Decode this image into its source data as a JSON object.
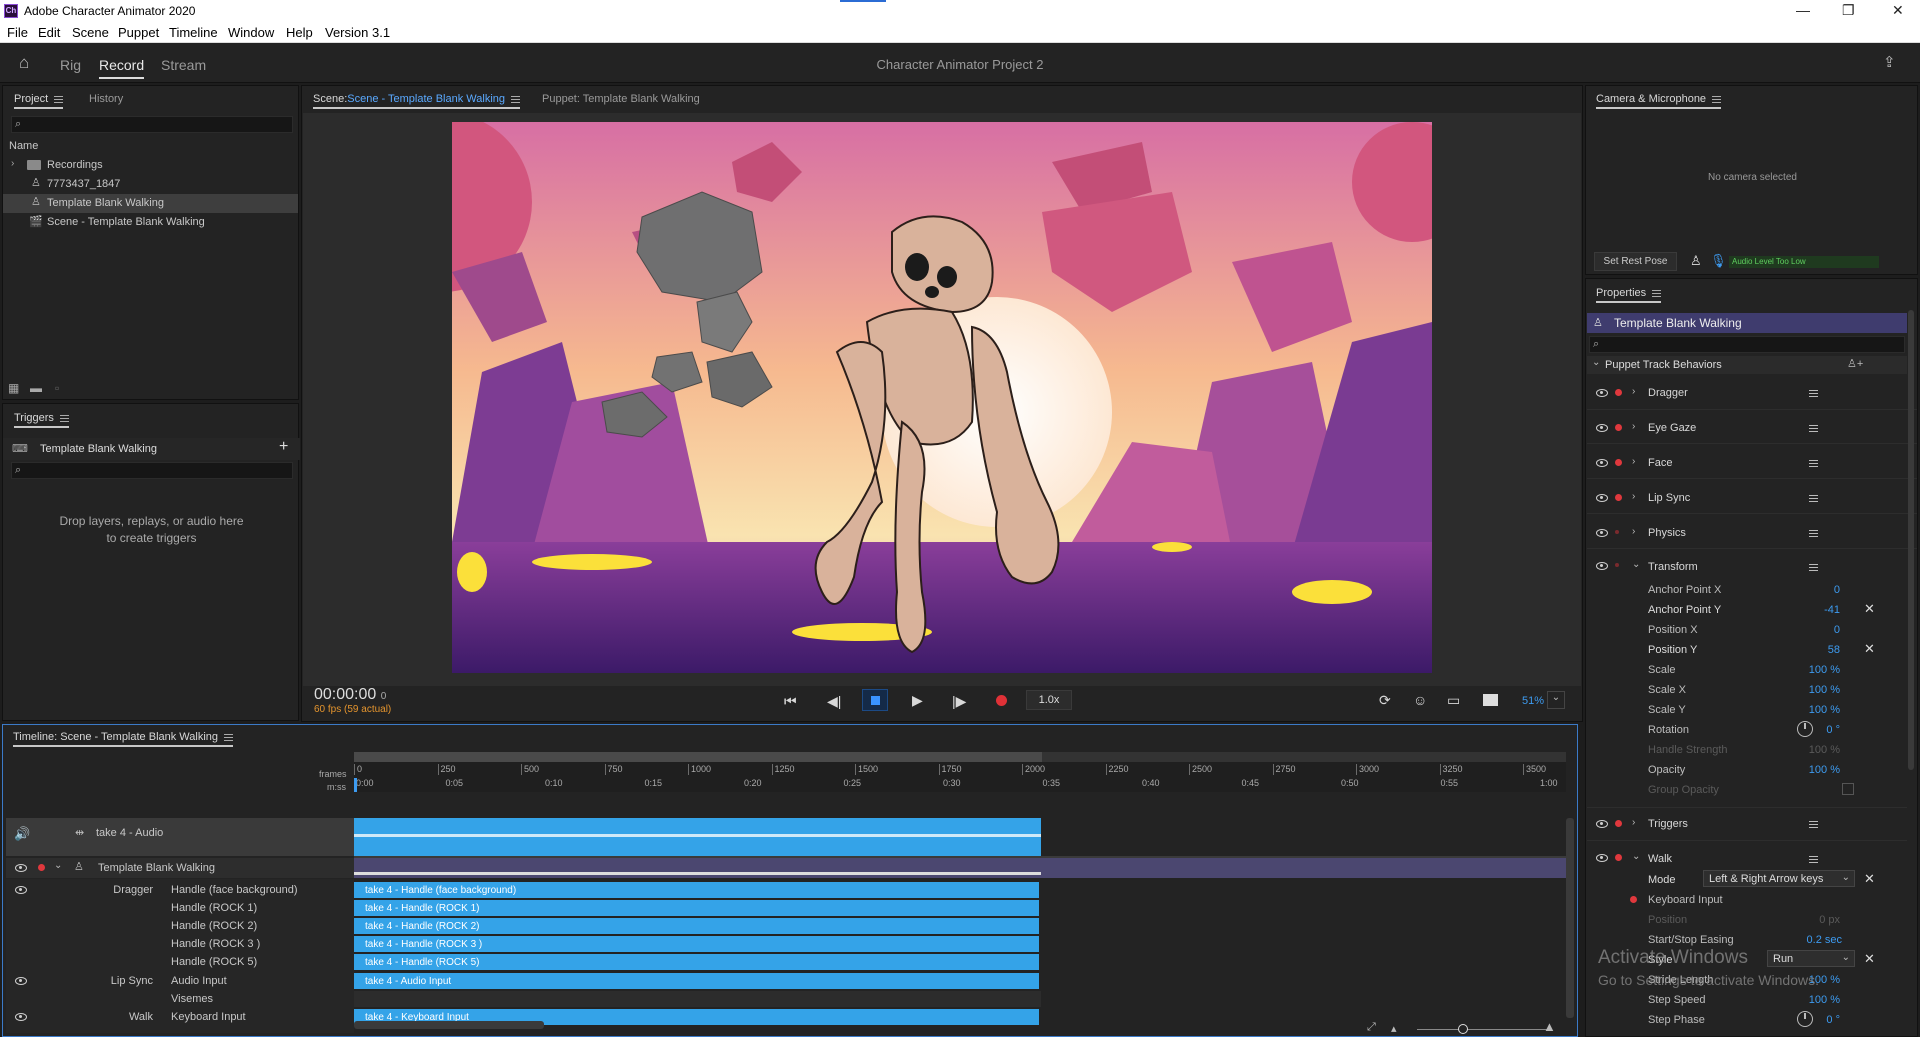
{
  "titlebar": {
    "icon": "Ch",
    "title": "Adobe Character Animator 2020"
  },
  "menu": [
    "File",
    "Edit",
    "Scene",
    "Puppet",
    "Timeline",
    "Window",
    "Help",
    "Version 3.1"
  ],
  "header": {
    "modes": [
      "Rig",
      "Record",
      "Stream"
    ],
    "project_title": "Character Animator Project 2"
  },
  "project_panel": {
    "tabs": [
      "Project",
      "History"
    ],
    "column": "Name",
    "items": [
      "Recordings",
      "7773437_1847",
      "Template Blank Walking",
      "Scene - Template Blank Walking"
    ]
  },
  "triggers_panel": {
    "title": "Triggers",
    "puppet": "Template Blank Walking",
    "hint_line1": "Drop layers, replays, or audio here",
    "hint_line2": "to create triggers"
  },
  "scene_panel": {
    "scene_prefix": "Scene:",
    "scene_tab": "Scene - Template Blank Walking",
    "puppet_tab": "Puppet: Template Blank Walking",
    "timecode": "00:00:00",
    "timecode_frame": "0",
    "fps": "60 fps (59 actual)",
    "speed": "1.0x",
    "zoom": "51%"
  },
  "camera_panel": {
    "title": "Camera & Microphone",
    "no_camera": "No camera selected",
    "set_rest_pose": "Set Rest Pose",
    "audio_level": "Audio Level Too Low"
  },
  "properties": {
    "title": "Properties",
    "puppet": "Template Blank Walking",
    "section": "Puppet Track Behaviors",
    "behaviors": [
      "Dragger",
      "Eye Gaze",
      "Face",
      "Lip Sync",
      "Physics",
      "Transform"
    ],
    "transform_params": [
      {
        "name": "Anchor Point X",
        "value": "0"
      },
      {
        "name": "Anchor Point Y",
        "value": "-41"
      },
      {
        "name": "Position X",
        "value": "0"
      },
      {
        "name": "Position Y",
        "value": "58"
      },
      {
        "name": "Scale",
        "value": "100 %"
      },
      {
        "name": "Scale X",
        "value": "100 %"
      },
      {
        "name": "Scale Y",
        "value": "100 %"
      },
      {
        "name": "Rotation",
        "value": "0 °"
      },
      {
        "name": "Handle Strength",
        "value": "100 %"
      },
      {
        "name": "Opacity",
        "value": "100 %"
      },
      {
        "name": "Group Opacity",
        "value": ""
      }
    ],
    "triggers": "Triggers",
    "walk": "Walk",
    "walk_params": {
      "mode_label": "Mode",
      "mode_value": "Left & Right Arrow keys",
      "keyboard_input": "Keyboard Input",
      "position_label": "Position",
      "position_value": "0 px",
      "easing_label": "Start/Stop Easing",
      "easing_value": "0.2 sec",
      "style_label": "Style",
      "style_value": "Run",
      "stride_label": "Stride Length",
      "stride_value": "100 %",
      "step_speed_label": "Step Speed",
      "step_speed_value": "100 %",
      "step_phase_label": "Step Phase",
      "step_phase_value": "0 °"
    },
    "watermark_title": "Activate Windows",
    "watermark_sub": "Go to Settings to activate Windows."
  },
  "timeline": {
    "title": "Timeline: Scene - Template Blank Walking",
    "frames_label": "frames",
    "mss_label": "m:ss",
    "frame_ticks": [
      "0",
      "250",
      "500",
      "750",
      "1000",
      "1250",
      "1500",
      "1750",
      "2000",
      "2250",
      "2500",
      "2750",
      "3000",
      "3250",
      "3500"
    ],
    "time_ticks": [
      "0:00",
      "0:05",
      "0:10",
      "0:15",
      "0:20",
      "0:25",
      "0:30",
      "0:35",
      "0:40",
      "0:45",
      "0:50",
      "0:55",
      "1:00"
    ],
    "audio_track": "take 4 - Audio",
    "puppet_track": "Template Blank Walking",
    "rows": [
      {
        "behavior": "Dragger",
        "param": "Handle (face background)",
        "bar": "take 4 - Handle (face background)"
      },
      {
        "behavior": "",
        "param": "Handle (ROCK 1)",
        "bar": "take 4 - Handle (ROCK 1)"
      },
      {
        "behavior": "",
        "param": "Handle (ROCK 2)",
        "bar": "take 4 - Handle (ROCK 2)"
      },
      {
        "behavior": "",
        "param": "Handle (ROCK 3 )",
        "bar": "take 4 - Handle (ROCK 3 )"
      },
      {
        "behavior": "",
        "param": "Handle (ROCK 5)",
        "bar": "take 4 - Handle (ROCK 5)"
      },
      {
        "behavior": "Lip Sync",
        "param": "Audio Input",
        "bar": "take 4 - Audio Input"
      },
      {
        "behavior": "",
        "param": "Visemes",
        "bar": ""
      },
      {
        "behavior": "Walk",
        "param": "Keyboard Input",
        "bar": "take 4 - Keyboard Input"
      }
    ]
  }
}
